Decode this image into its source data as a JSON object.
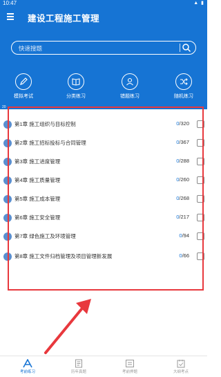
{
  "status_bar": {
    "time": "10:47"
  },
  "app_bar": {
    "title": "建设工程施工管理"
  },
  "search": {
    "placeholder": "快速搜题"
  },
  "tools": [
    {
      "label": "模拟考试",
      "icon": "pen-icon"
    },
    {
      "label": "分类练习",
      "icon": "book-icon"
    },
    {
      "label": "错题练习",
      "icon": "user-icon"
    },
    {
      "label": "随机练习",
      "icon": "shuffle-icon"
    }
  ],
  "strip": {
    "left": "20",
    "right": ""
  },
  "chapters": [
    {
      "name": "第1章 施工组织与目标控制",
      "done": "0",
      "total": "/320"
    },
    {
      "name": "第2章 施工招标投标与合同管理",
      "done": "0",
      "total": "/367"
    },
    {
      "name": "第3章 施工进度管理",
      "done": "0",
      "total": "/288"
    },
    {
      "name": "第4章 施工质量管理",
      "done": "0",
      "total": "/260"
    },
    {
      "name": "第5章 施工成本管理",
      "done": "0",
      "total": "/268"
    },
    {
      "name": "第6章 施工安全管理",
      "done": "0",
      "total": "/217"
    },
    {
      "name": "第7章 绿色施工及环境管理",
      "done": "0",
      "total": "/94"
    },
    {
      "name": "第8章 施工文件归档管理及项目管理新发展",
      "done": "0",
      "total": "/66"
    }
  ],
  "bottom_nav": [
    {
      "label": "考前练习",
      "icon": "practice-icon"
    },
    {
      "label": "历年真题",
      "icon": "papers-icon"
    },
    {
      "label": "考前押题",
      "icon": "prediction-icon"
    },
    {
      "label": "大纲考点",
      "icon": "syllabus-icon"
    }
  ],
  "colors": {
    "primary": "#1674d4",
    "highlight": "#e8383d"
  }
}
